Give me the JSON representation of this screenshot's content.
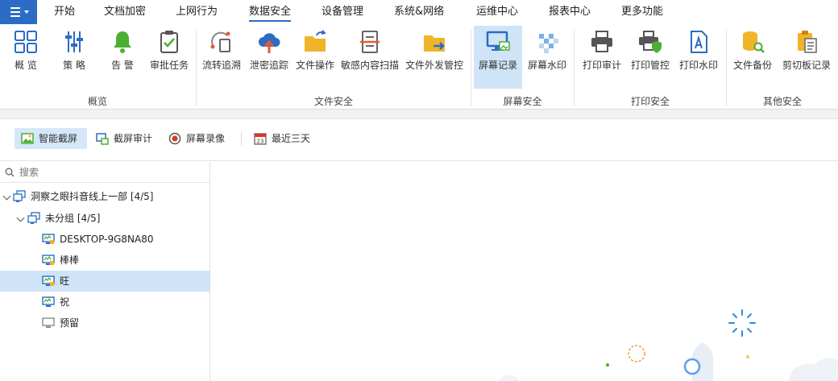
{
  "menubar": {
    "items": [
      {
        "label": "开始"
      },
      {
        "label": "文档加密"
      },
      {
        "label": "上网行为"
      },
      {
        "label": "数据安全"
      },
      {
        "label": "设备管理"
      },
      {
        "label": "系统&网络"
      },
      {
        "label": "运维中心"
      },
      {
        "label": "报表中心"
      },
      {
        "label": "更多功能"
      }
    ],
    "active": "数据安全"
  },
  "ribbon": {
    "buttons": {
      "overview": "概 览",
      "policy": "策 略",
      "alert": "告 警",
      "approval": "审批任务",
      "flow_trace": "流转追溯",
      "leak_trace": "泄密追踪",
      "file_ops": "文件操作",
      "sensitive_scan": "敏感内容扫描",
      "outbound_control": "文件外发管控",
      "screen_record": "屏幕记录",
      "screen_watermark": "屏幕水印",
      "print_audit": "打印审计",
      "print_control": "打印管控",
      "print_watermark": "打印水印",
      "file_backup": "文件备份",
      "clipboard_record": "剪切板记录"
    },
    "groups": {
      "overview": "概览",
      "file_security": "文件安全",
      "screen_security": "屏幕安全",
      "print_security": "打印安全",
      "other_security": "其他安全"
    }
  },
  "toolbar": {
    "smart_capture": "智能截屏",
    "capture_audit": "截屏审计",
    "screen_video": "屏幕录像",
    "date_range": "最近三天"
  },
  "search": {
    "placeholder": "搜索"
  },
  "tree": {
    "root": "洞察之眼抖音线上一部  [4/5]",
    "group": "未分组  [4/5]",
    "devices": [
      {
        "name": "DESKTOP-9G8NA80"
      },
      {
        "name": "棒棒"
      },
      {
        "name": "旺"
      },
      {
        "name": "祝"
      },
      {
        "name": "预留"
      }
    ],
    "selected": "旺"
  },
  "colors": {
    "accent": "#2b6cc4",
    "selected_bg": "#cfe4f7",
    "alert_green": "#4cae33",
    "folder_yellow": "#f0b429",
    "leak_orange": "#e8592c"
  }
}
